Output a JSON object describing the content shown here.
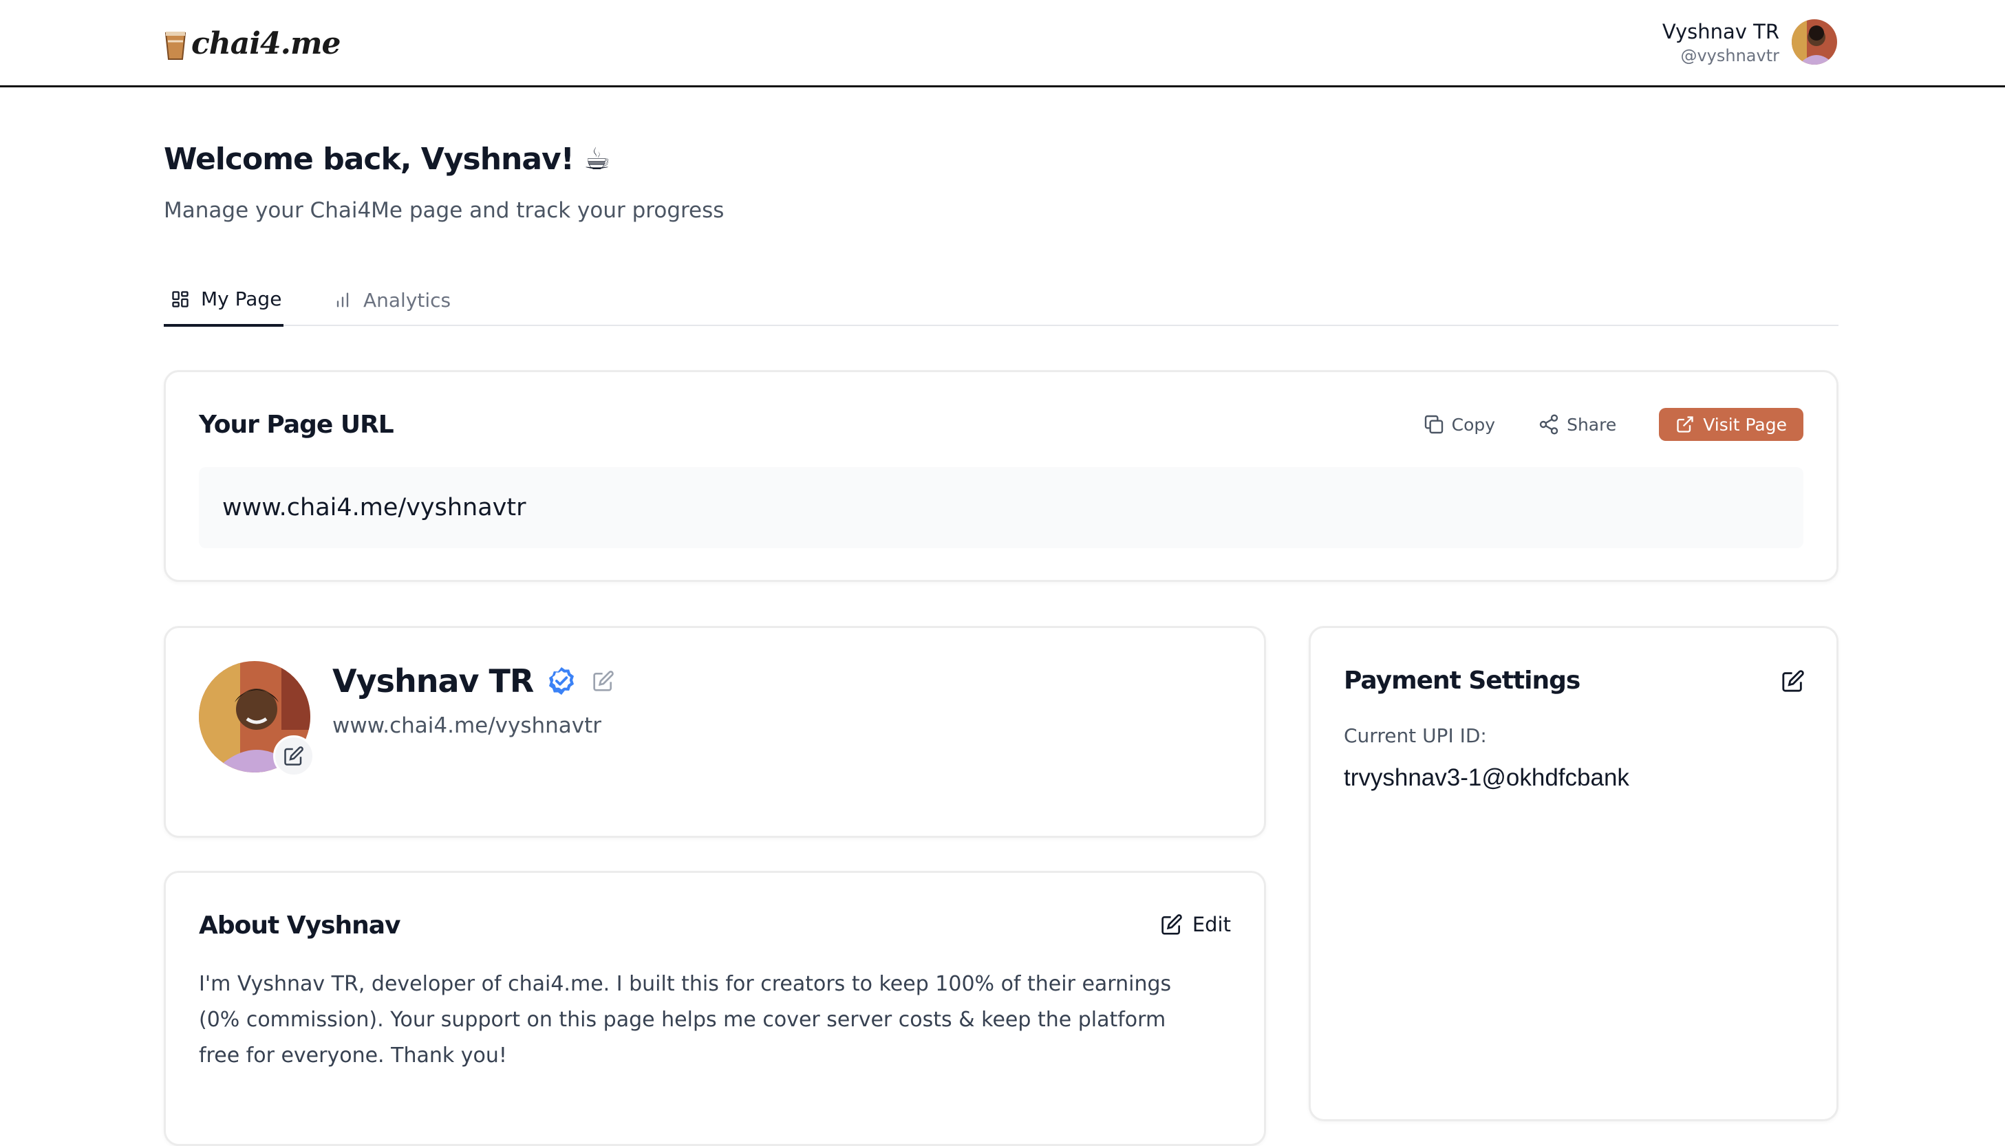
{
  "header": {
    "logo_text": "chai4.me",
    "user_name": "Vyshnav TR",
    "user_handle": "@vyshnavtr"
  },
  "welcome": {
    "title": "Welcome back, Vyshnav! ☕",
    "subtitle": "Manage your Chai4Me page and track your progress"
  },
  "tabs": [
    {
      "label": "My Page",
      "icon": "dashboard-grid-icon",
      "active": true
    },
    {
      "label": "Analytics",
      "icon": "bar-chart-icon",
      "active": false
    }
  ],
  "page_url_card": {
    "title": "Your Page URL",
    "copy_label": "Copy",
    "share_label": "Share",
    "visit_label": "Visit Page",
    "url": "www.chai4.me/vyshnavtr"
  },
  "profile_card": {
    "name": "Vyshnav TR",
    "url": "www.chai4.me/vyshnavtr",
    "verified": true
  },
  "payment_card": {
    "title": "Payment Settings",
    "upi_label": "Current UPI ID:",
    "upi_value": "trvyshnav3-1@okhdfcbank"
  },
  "about_card": {
    "title": "About Vyshnav",
    "edit_label": "Edit",
    "text": "I'm Vyshnav TR, developer of chai4.me. I built this for creators to keep 100% of their earnings (0% commission). Your support on this page helps me cover server costs & keep the platform free for everyone. Thank you!"
  },
  "colors": {
    "accent": "#c76b49",
    "verified": "#3b82f6",
    "text_primary": "#111827",
    "text_muted": "#6b7280"
  }
}
